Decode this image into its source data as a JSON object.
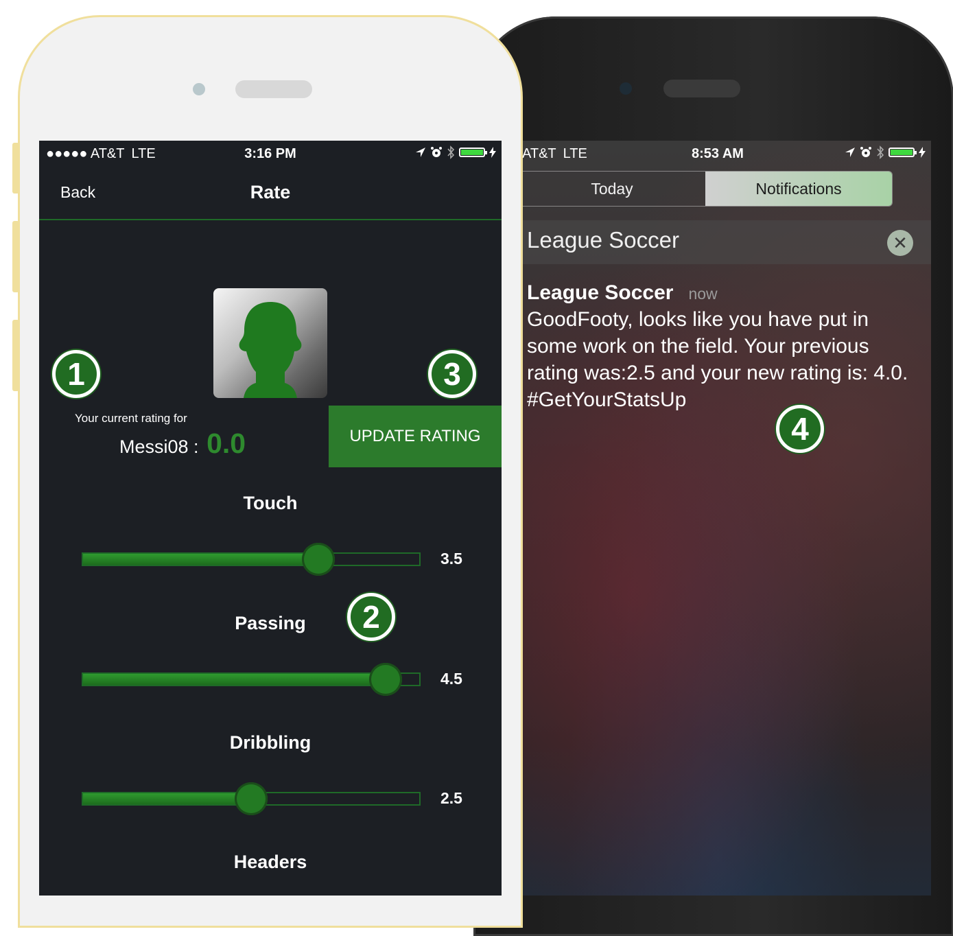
{
  "notification_phone": {
    "status_bar": {
      "carrier": "AT&T",
      "network": "LTE",
      "time": "8:53 AM"
    },
    "tabs": [
      {
        "label": "Today",
        "active": false
      },
      {
        "label": "Notifications",
        "active": true
      }
    ],
    "group_header": {
      "app_name": "League Soccer",
      "close_icon": "close-icon"
    },
    "notification": {
      "title": "League Soccer",
      "time": "now",
      "message": "GoodFooty, looks like you have put in some work on the field. Your previous rating was:2.5 and your new rating is: 4.0. #GetYourStatsUp"
    }
  },
  "rate_phone": {
    "status_bar": {
      "signal": "●●●●●",
      "carrier": "AT&T",
      "network": "LTE",
      "time": "3:16 PM"
    },
    "navbar": {
      "back_label": "Back",
      "title": "Rate"
    },
    "rating": {
      "caption": "Your current rating for",
      "username": "Messi08",
      "separator": " : ",
      "value": "0.0"
    },
    "update_button_label": "UPDATE RATING",
    "skills": [
      {
        "label": "Touch",
        "value": "3.5",
        "fraction": 0.7
      },
      {
        "label": "Passing",
        "value": "4.5",
        "fraction": 0.9
      },
      {
        "label": "Dribbling",
        "value": "2.5",
        "fraction": 0.5
      },
      {
        "label": "Headers"
      }
    ]
  },
  "markers": [
    "1",
    "2",
    "3",
    "4"
  ],
  "colors": {
    "accent_green": "#2c7b2c",
    "dark_screen": "#1c1f24",
    "phone_gold": "#f0df9c",
    "battery_green": "#3fd83f"
  }
}
